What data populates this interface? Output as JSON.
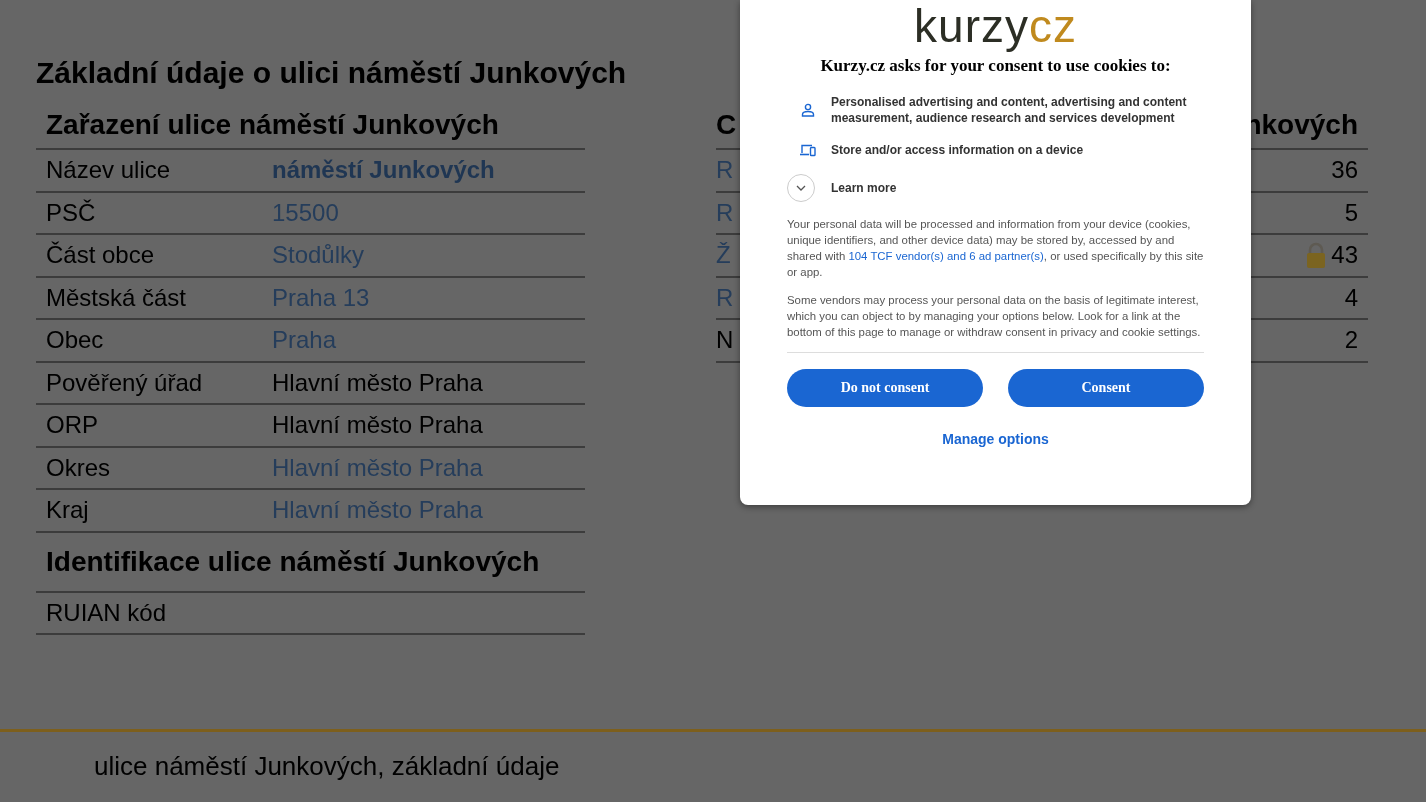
{
  "page": {
    "title": "Základní údaje o ulici náměstí Junkových",
    "classification": {
      "heading": "Zařazení ulice náměstí Junkových",
      "rows": [
        {
          "label": "Název ulice",
          "value": "náměstí Junkových",
          "kind": "strong-link"
        },
        {
          "label": "PSČ",
          "value": "15500",
          "kind": "link"
        },
        {
          "label": "Část obce",
          "value": "Stodůlky",
          "kind": "link"
        },
        {
          "label": "Městská část",
          "value": "Praha 13",
          "kind": "link"
        },
        {
          "label": "Obec",
          "value": "Praha",
          "kind": "link"
        },
        {
          "label": "Pověřený úřad",
          "value": "Hlavní město Praha",
          "kind": "text"
        },
        {
          "label": "ORP",
          "value": "Hlavní město Praha",
          "kind": "text"
        },
        {
          "label": "Okres",
          "value": "Hlavní město Praha",
          "kind": "link"
        },
        {
          "label": "Kraj",
          "value": "Hlavní město Praha",
          "kind": "link"
        }
      ]
    },
    "identification": {
      "heading": "Identifikace ulice náměstí Junkových",
      "rows": [
        {
          "label": "RUIAN kód"
        }
      ]
    },
    "counts": {
      "heading_start": "C",
      "heading_end": "nkových",
      "rows": [
        {
          "label": "R",
          "value": "36",
          "kind": "link",
          "locked": false
        },
        {
          "label": "R",
          "value": "5",
          "kind": "link",
          "locked": false
        },
        {
          "label": "Ž",
          "value": "43",
          "kind": "link",
          "locked": true
        },
        {
          "label": "R",
          "value": "4",
          "kind": "link",
          "locked": false
        },
        {
          "label": "N",
          "value": "2",
          "kind": "text",
          "locked": false
        }
      ]
    },
    "footer": "ulice náměstí Junkových, základní údaje"
  },
  "consent_dialog": {
    "logo": {
      "part_1": "kurzy",
      "part_2": "cz"
    },
    "title": "Kurzy.cz asks for your consent to use cookies to:",
    "purposes": [
      {
        "kind": "person",
        "text": "Personalised advertising and content, advertising and content measurement, audience research and services development"
      },
      {
        "kind": "device",
        "text": "Store and/or access information on a device"
      }
    ],
    "learn_more": "Learn more",
    "paragraphs": [
      {
        "before": "Your personal data will be processed and information from your device (cookies, unique identifiers, and other device data) may be stored by, accessed by and shared with ",
        "link": "104 TCF vendor(s) and 6 ad partner(s)",
        "after": ", or used specifically by this site or app."
      },
      {
        "before": "Some vendors may process your personal data on the basis of legitimate interest, which you can object to by managing your options below. Look for a link at the bottom of this page to manage or withdraw consent in privacy and cookie settings."
      }
    ],
    "buttons": [
      "Do not consent",
      "Consent"
    ],
    "manage_options": "Manage options"
  }
}
